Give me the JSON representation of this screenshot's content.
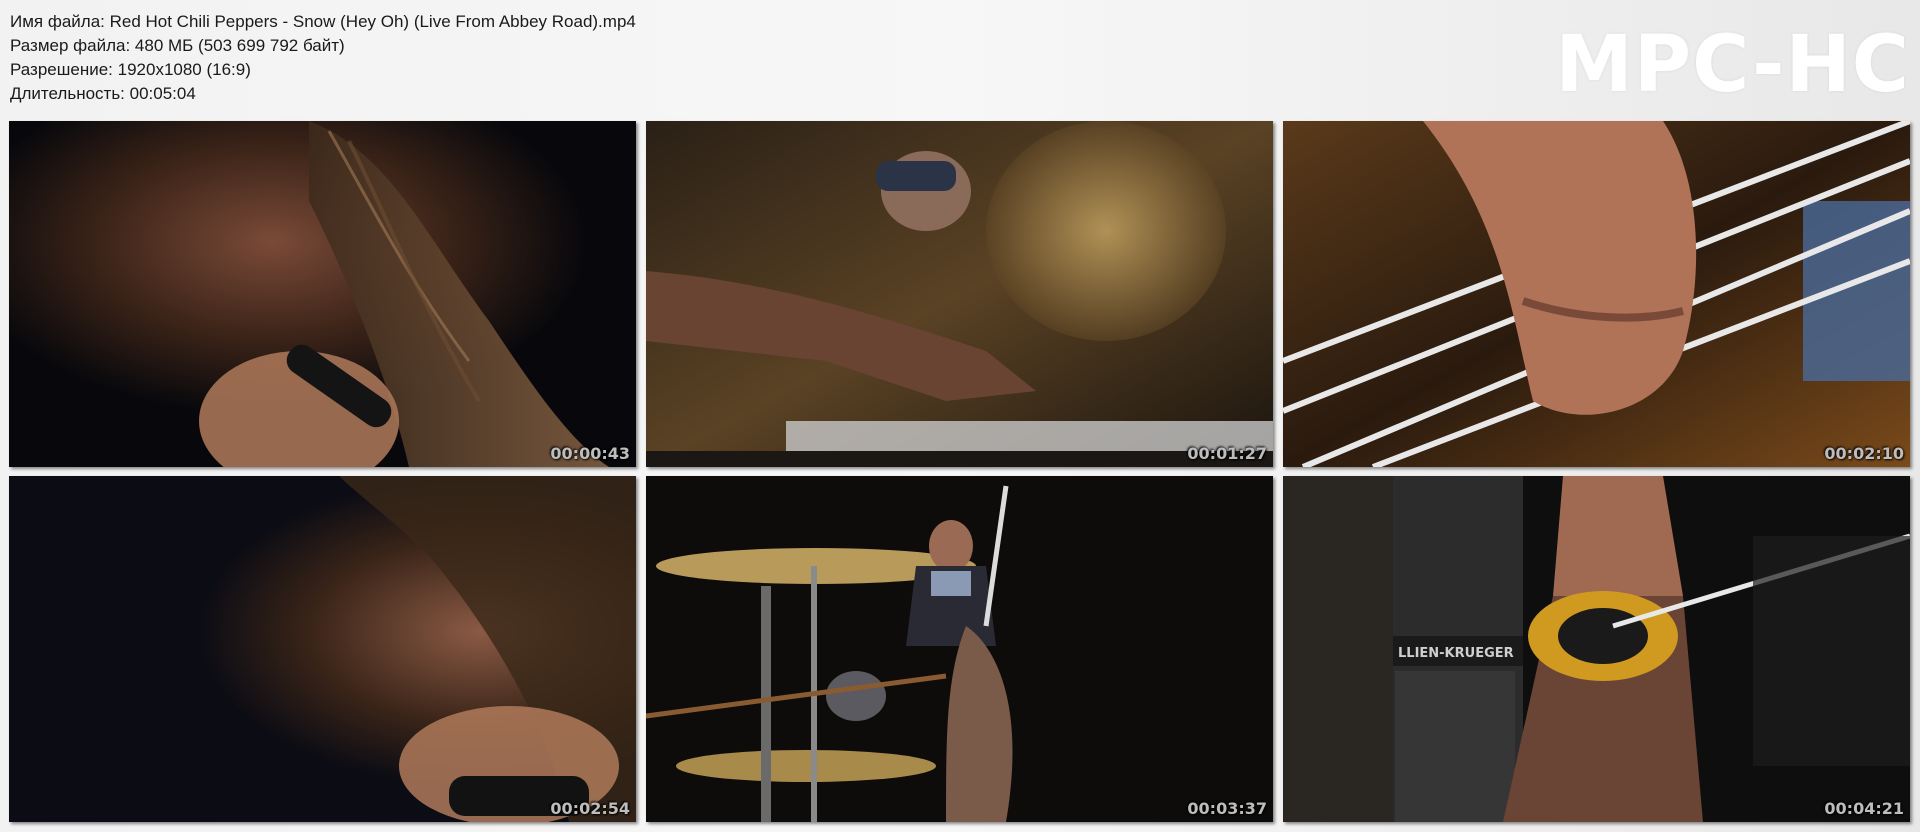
{
  "info": {
    "filename": "Имя файла: Red Hot Chili Peppers - Snow (Hey Oh) (Live From Abbey Road).mp4",
    "filesize": "Размер файла: 480 МБ (503 699 792 байт)",
    "resolution": "Разрешение: 1920x1080 (16:9)",
    "duration": "Длительность: 00:05:04"
  },
  "logo": "MPC-HC",
  "thumbnails": [
    {
      "timestamp": "00:00:43",
      "scene": "singer-closeup-microphone"
    },
    {
      "timestamp": "00:01:27",
      "scene": "drummer-hand-cymbal"
    },
    {
      "timestamp": "00:02:10",
      "scene": "bass-strings-hand"
    },
    {
      "timestamp": "00:02:54",
      "scene": "singer-closeup-dark"
    },
    {
      "timestamp": "00:03:37",
      "scene": "singer-behind-drum-kit"
    },
    {
      "timestamp": "00:04:21",
      "scene": "bassist-amplifier"
    }
  ]
}
